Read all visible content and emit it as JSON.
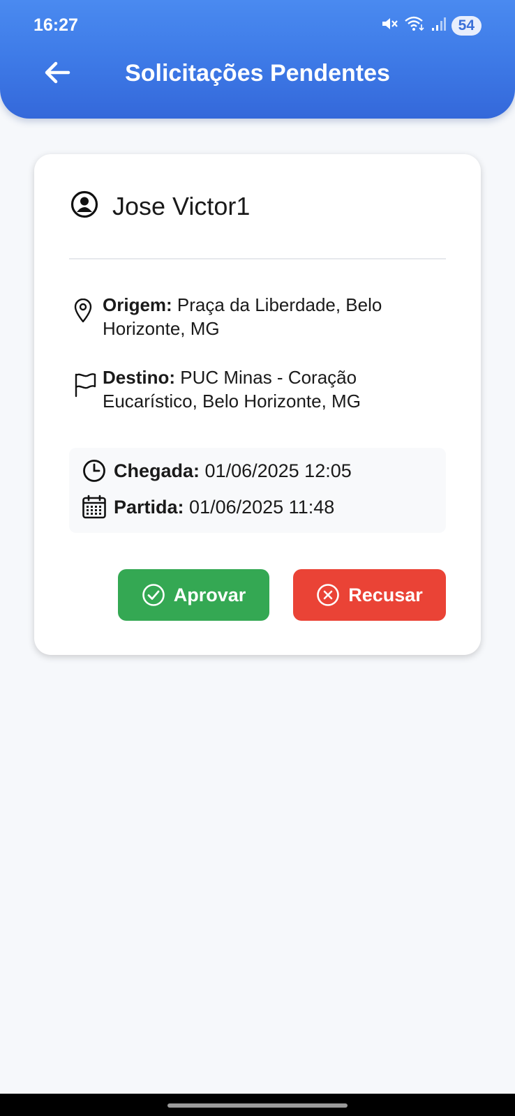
{
  "status_bar": {
    "time": "16:27",
    "battery": "54",
    "icons": [
      "mute-icon",
      "wifi-icon",
      "signal-icon",
      "battery-icon"
    ]
  },
  "header": {
    "title": "Solicitações Pendentes",
    "back_icon": "arrow-left-icon"
  },
  "request": {
    "user_name": "Jose Victor1",
    "origin_label": "Origem:",
    "origin_value": "Praça da Liberdade, Belo Horizonte, MG",
    "destination_label": "Destino:",
    "destination_value": "PUC Minas - Coração Eucarístico, Belo Horizonte, MG",
    "arrival_label": "Chegada:",
    "arrival_value": "01/06/2025 12:05",
    "departure_label": "Partida:",
    "departure_value": "01/06/2025 11:48",
    "approve_label": "Aprovar",
    "reject_label": "Recusar"
  },
  "colors": {
    "header": "#3f7ce8",
    "approve": "#34a853",
    "reject": "#ea4336",
    "background": "#f6f8fb"
  }
}
